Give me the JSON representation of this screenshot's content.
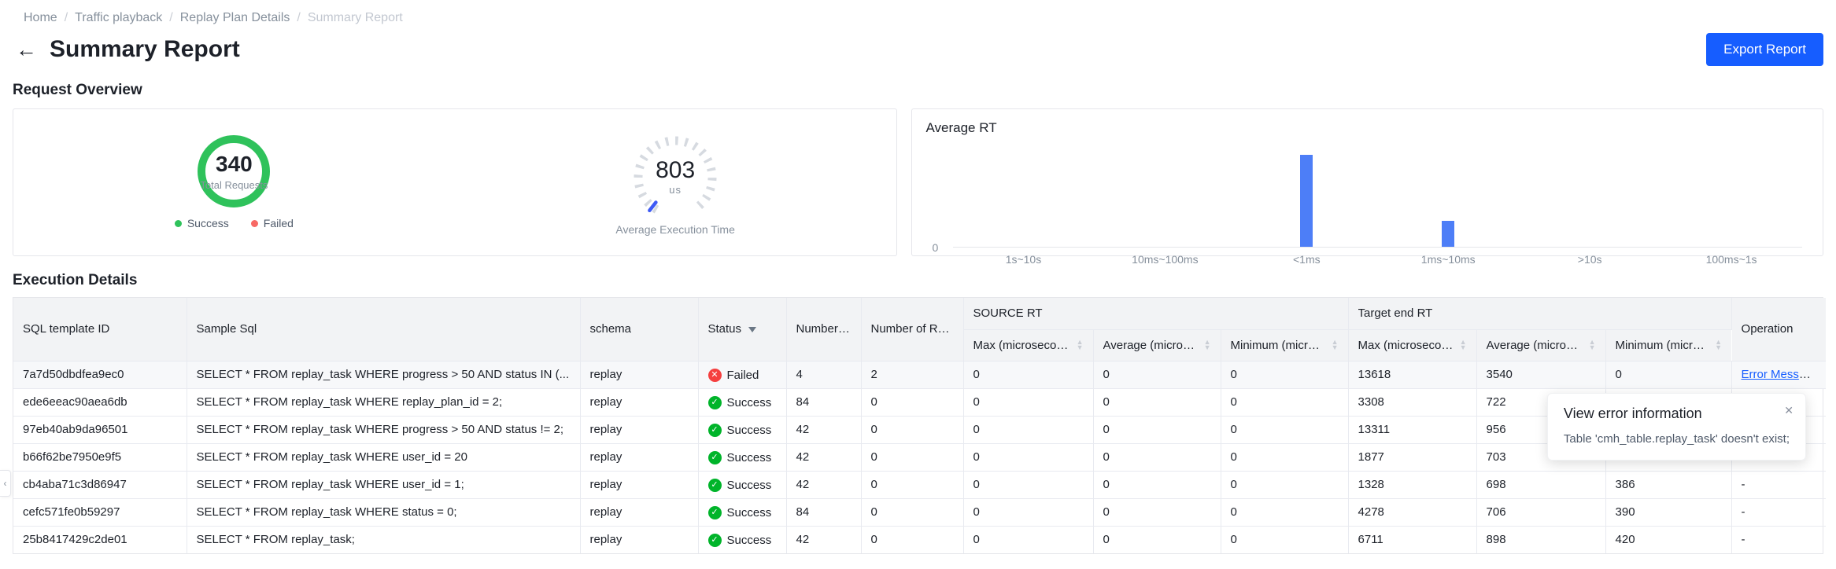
{
  "colors": {
    "primary": "#165DFF",
    "success_green": "#2FC25B",
    "failed_pink": "#F76965",
    "failed_red": "#F53F3F",
    "success_icon_green": "#00B42A",
    "bar_blue": "#4D7EF7"
  },
  "icons": {
    "back_arrow": "←",
    "close": "✕",
    "success_check": "✓",
    "failed_cross": "✕",
    "sort_up": "▲",
    "sort_down": "▼",
    "handle": "‹"
  },
  "breadcrumb": {
    "items": [
      "Home",
      "Traffic playback",
      "Replay Plan Details",
      "Summary Report"
    ]
  },
  "page": {
    "title": "Summary Report",
    "export_button": "Export Report"
  },
  "request_overview": {
    "title": "Request Overview",
    "total": {
      "value": "340",
      "label": "Total Requests",
      "legend_success": "Success",
      "legend_failed": "Failed"
    },
    "avg_time": {
      "value": "803",
      "unit": "us",
      "caption": "Average Execution Time"
    }
  },
  "chart_data": {
    "type": "bar",
    "title": "Average RT",
    "categories": [
      "1s~10s",
      "10ms~100ms",
      "<1ms",
      "1ms~10ms",
      ">10s",
      "100ms~1s"
    ],
    "values": [
      0,
      0,
      265,
      75,
      0,
      0
    ],
    "xlabel": "",
    "ylabel": "",
    "y_tick": "0",
    "ylim": [
      0,
      290
    ],
    "grid": false,
    "legend_position": "none",
    "bar_color": "#4D7EF7"
  },
  "execution_details": {
    "title": "Execution Details",
    "columns": {
      "sql_template_id": "SQL template ID",
      "sample_sql": "Sample Sql",
      "schema": "schema",
      "status": "Status",
      "number": "Number ...",
      "number_of_re": "Number of Re...",
      "source_rt": "SOURCE RT",
      "target_rt": "Target end RT",
      "max_us": "Max (microseconds)...",
      "avg_us": "Average (microsecond...",
      "min_us": "Minimum (microsecon...",
      "operation": "Operation"
    },
    "rows": [
      {
        "id": "7a7d50dbdfea9ec0",
        "sql": "SELECT * FROM replay_task WHERE progress > 50 AND status IN (...",
        "schema": "replay",
        "status": "Failed",
        "number": "4",
        "number_re": "2",
        "s_max": "0",
        "s_avg": "0",
        "s_min": "0",
        "t_max": "13618",
        "t_avg": "3540",
        "t_min": "0",
        "operation": "Error Message"
      },
      {
        "id": "ede6eeac90aea6db",
        "sql": "SELECT * FROM replay_task WHERE replay_plan_id = 2;",
        "schema": "replay",
        "status": "Success",
        "number": "84",
        "number_re": "0",
        "s_max": "0",
        "s_avg": "0",
        "s_min": "0",
        "t_max": "3308",
        "t_avg": "722",
        "t_min": "",
        "operation": "-"
      },
      {
        "id": "97eb40ab9da96501",
        "sql": "SELECT * FROM replay_task WHERE progress > 50 AND status != 2;",
        "schema": "replay",
        "status": "Success",
        "number": "42",
        "number_re": "0",
        "s_max": "0",
        "s_avg": "0",
        "s_min": "0",
        "t_max": "13311",
        "t_avg": "956",
        "t_min": "",
        "operation": "-"
      },
      {
        "id": "b66f62be7950e9f5",
        "sql": "SELECT * FROM replay_task WHERE user_id = 20",
        "schema": "replay",
        "status": "Success",
        "number": "42",
        "number_re": "0",
        "s_max": "0",
        "s_avg": "0",
        "s_min": "0",
        "t_max": "1877",
        "t_avg": "703",
        "t_min": "",
        "operation": "-"
      },
      {
        "id": "cb4aba71c3d86947",
        "sql": "SELECT * FROM replay_task WHERE user_id = 1;",
        "schema": "replay",
        "status": "Success",
        "number": "42",
        "number_re": "0",
        "s_max": "0",
        "s_avg": "0",
        "s_min": "0",
        "t_max": "1328",
        "t_avg": "698",
        "t_min": "386",
        "operation": "-"
      },
      {
        "id": "cefc571fe0b59297",
        "sql": "SELECT * FROM replay_task WHERE status = 0;",
        "schema": "replay",
        "status": "Success",
        "number": "84",
        "number_re": "0",
        "s_max": "0",
        "s_avg": "0",
        "s_min": "0",
        "t_max": "4278",
        "t_avg": "706",
        "t_min": "390",
        "operation": "-"
      },
      {
        "id": "25b8417429c2de01",
        "sql": "SELECT * FROM replay_task;",
        "schema": "replay",
        "status": "Success",
        "number": "42",
        "number_re": "0",
        "s_max": "0",
        "s_avg": "0",
        "s_min": "0",
        "t_max": "6711",
        "t_avg": "898",
        "t_min": "420",
        "operation": "-"
      }
    ]
  },
  "error_popup": {
    "title": "View error information",
    "message": "Table 'cmh_table.replay_task' doesn't exist;"
  }
}
